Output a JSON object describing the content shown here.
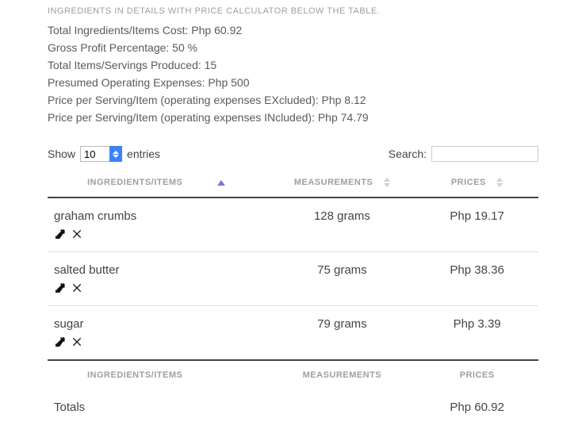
{
  "section_title": "INGREDIENTS IN DETAILS WITH PRICE CALCULATOR BELOW THE TABLE.",
  "summary": {
    "total_cost_label": "Total Ingredients/Items Cost: Php 60.92",
    "gross_profit_label": "Gross Profit Percentage: 50 %",
    "servings_label": "Total Items/Servings Produced: 15",
    "opex_label": "Presumed Operating Expenses: Php 500",
    "price_ex_label": "Price per Serving/Item (operating expenses EXcluded): Php 8.12",
    "price_in_label": "Price per Serving/Item (operating expenses INcluded): Php 74.79"
  },
  "controls": {
    "show_label": "Show",
    "entries_label": "entries",
    "length_value": "10",
    "search_label": "Search:",
    "search_value": ""
  },
  "headers": {
    "ingredients": "Ingredients/Items",
    "measurements": "Measurements",
    "prices": "Prices"
  },
  "rows": [
    {
      "name": "graham crumbs",
      "measurement": "128 grams",
      "price": "Php 19.17"
    },
    {
      "name": "salted butter",
      "measurement": "75 grams",
      "price": "Php 38.36"
    },
    {
      "name": "sugar",
      "measurement": "79 grams",
      "price": "Php 3.39"
    }
  ],
  "totals": {
    "label": "Totals",
    "price": "Php 60.92"
  }
}
